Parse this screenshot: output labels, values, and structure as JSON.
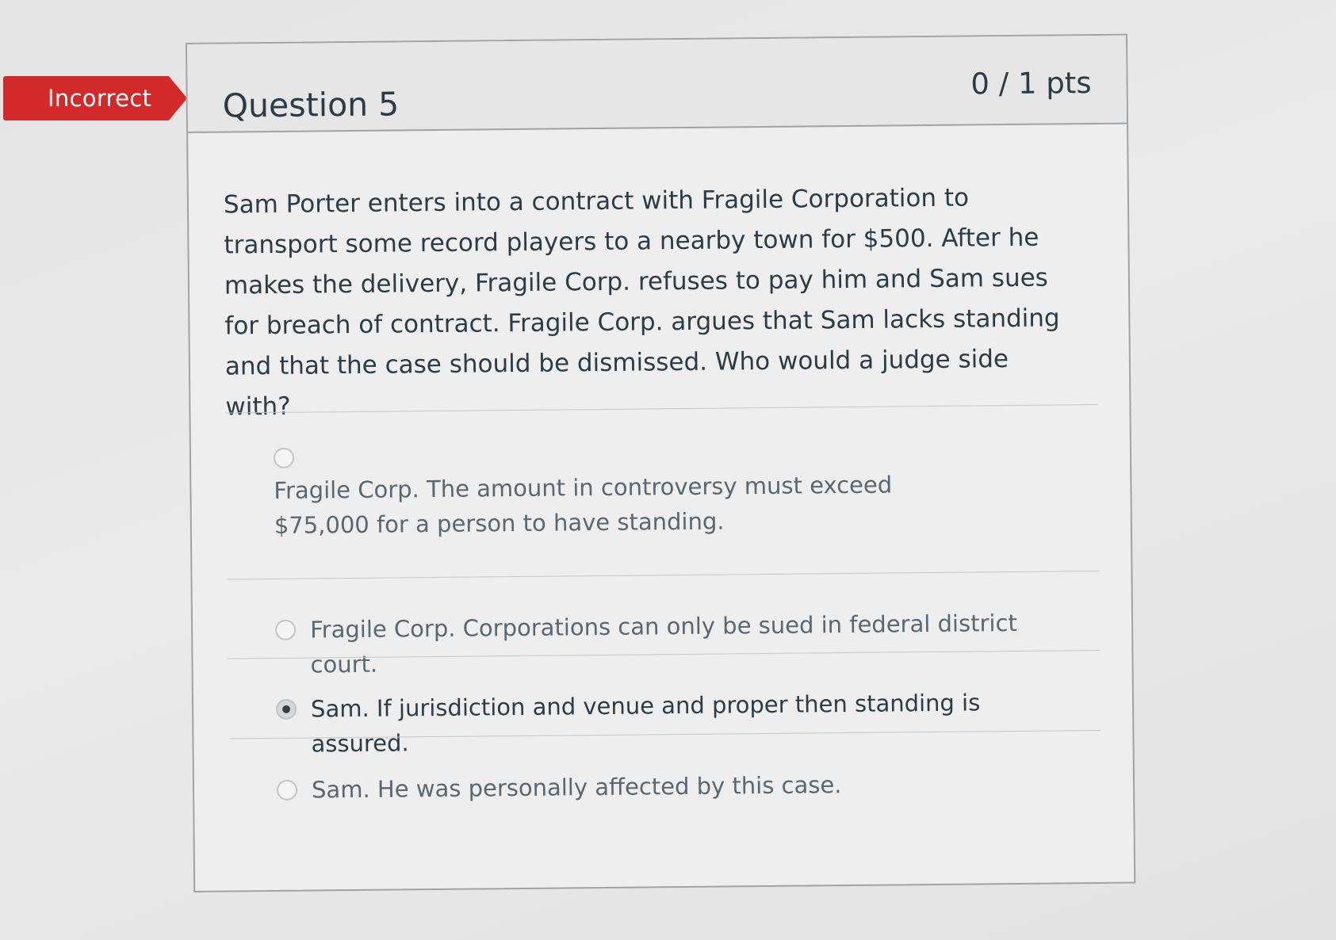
{
  "status_flag": {
    "label": "Incorrect",
    "color": "#d22a2a"
  },
  "question": {
    "title": "Question 5",
    "points": "0 / 1 pts",
    "text": "Sam Porter enters into a contract with Fragile Corporation to transport some record players to a nearby town for $500.  After he makes the delivery, Fragile Corp. refuses to pay him and Sam sues for breach of contract.  Fragile Corp. argues that Sam lacks standing and that the case should be dismissed.  Who would a judge side with?"
  },
  "answers": [
    {
      "text": "Fragile Corp. The amount in controversy must exceed $75,000 for a person to have standing.",
      "selected": false
    },
    {
      "text": "Fragile Corp. Corporations can only be sued in federal district court.",
      "selected": false
    },
    {
      "text": "Sam. If jurisdiction and venue and proper then standing is assured.",
      "selected": true
    },
    {
      "text": "Sam. He was personally affected by this case.",
      "selected": false
    }
  ]
}
